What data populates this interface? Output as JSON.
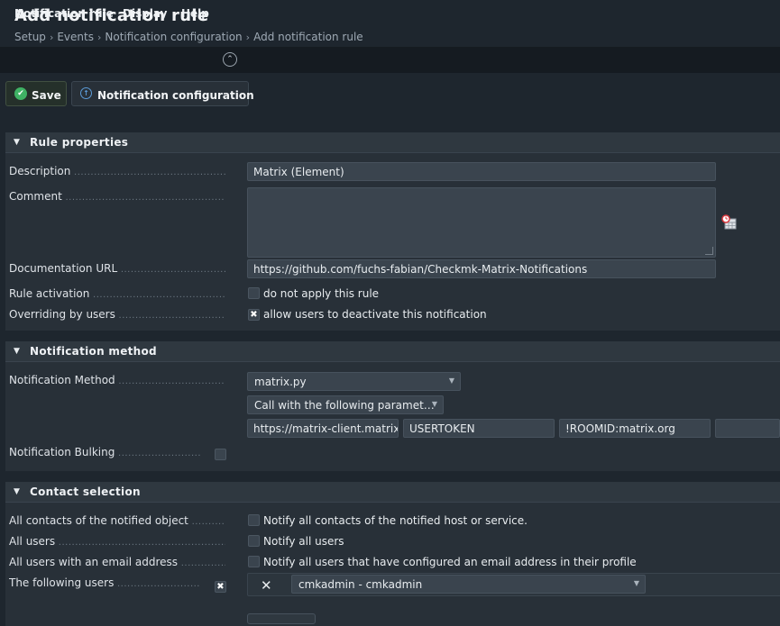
{
  "page": {
    "title": "Add notification rule",
    "breadcrumbs": [
      "Setup",
      "Events",
      "Notification configuration",
      "Add notification rule"
    ]
  },
  "menu": {
    "items": [
      "Notification rule",
      "Display",
      "Help"
    ]
  },
  "toolbar": {
    "save_label": "Save",
    "notification_config_label": "Notification configuration"
  },
  "rule_properties": {
    "title": "Rule properties",
    "description_label": "Description",
    "description_value": "Matrix (Element)",
    "comment_label": "Comment",
    "comment_value": "",
    "doc_url_label": "Documentation URL",
    "doc_url_value": "https://github.com/fuchs-fabian/Checkmk-Matrix-Notifications",
    "activation_label": "Rule activation",
    "activation_checkbox_label": "do not apply this rule",
    "activation_checked": false,
    "overriding_label": "Overriding by users",
    "overriding_checkbox_label": "allow users to deactivate this notification",
    "overriding_checked": true
  },
  "notification_method": {
    "title": "Notification method",
    "method_label": "Notification Method",
    "method_value": "matrix.py",
    "call_value": "Call with the following paramet…",
    "params": [
      "https://matrix-client.matrix.org",
      "USERTOKEN",
      "!ROOMID:matrix.org",
      ""
    ],
    "bulking_label": "Notification Bulking",
    "bulking_checked": false
  },
  "contact_selection": {
    "title": "Contact selection",
    "all_contacts_label": "All contacts of the notified object",
    "all_contacts_checkbox_label": "Notify all contacts of the notified host or service.",
    "all_users_label": "All users",
    "all_users_checkbox_label": "Notify all users",
    "all_users_email_label": "All users with an email address",
    "all_users_email_checkbox_label": "Notify all users that have configured an email address in their profile",
    "following_users_label": "The following users",
    "following_users_checked": true,
    "selected_user": "cmkadmin - cmkadmin"
  },
  "icons": {
    "save": "check-circle-icon",
    "notification_config": "arrow-up-circle-icon",
    "collapse": "chevron-up-circle-icon",
    "timestamp": "clock-calendar-icon",
    "remove": "close-icon"
  },
  "colors": {
    "background": "#1e262e",
    "section": "#283038",
    "input": "#3a444e",
    "accent_green": "#3fb264",
    "accent_blue": "#5b9bd8",
    "accent_red": "#d9383e"
  }
}
